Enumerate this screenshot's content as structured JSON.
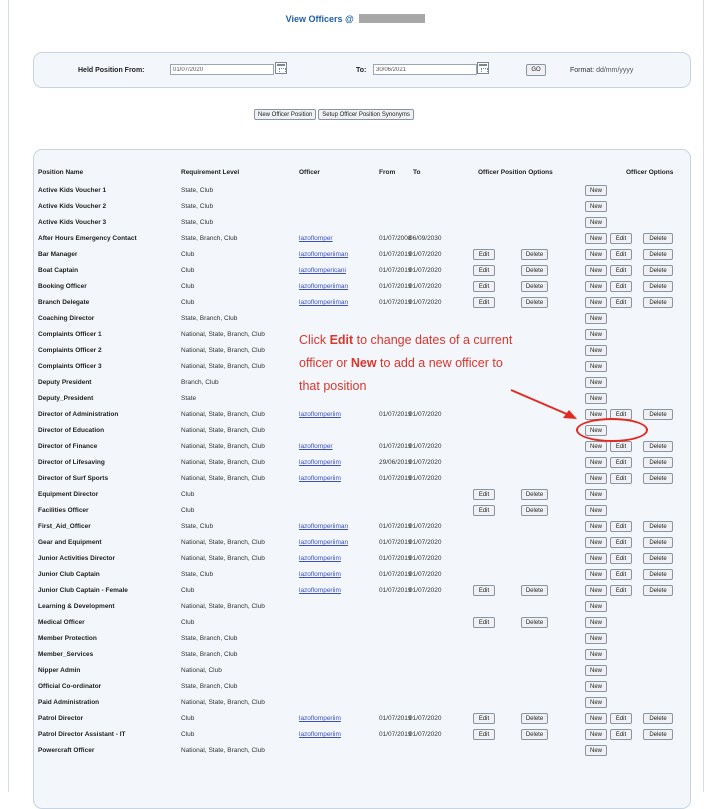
{
  "page": {
    "title": "View Officers @"
  },
  "filter": {
    "held_from_label": "Held Position From:",
    "held_from_value": "01/07/2020",
    "to_label": "To:",
    "to_value": "30/06/2021",
    "go_label": "GO",
    "format_label": "Format:",
    "format_value": "dd/mm/yyyy"
  },
  "actions": {
    "new_officer_position": "New Officer Position",
    "setup_synonyms": "Setup Officer Position Synonyms"
  },
  "table": {
    "headers": {
      "position_name": "Position Name",
      "requirement_level": "Requirement Level",
      "officer": "Officer",
      "from": "From",
      "to": "To",
      "officer_position_options": "Officer Position Options",
      "officer_options": "Officer Options"
    },
    "buttons": {
      "new": "New",
      "edit": "Edit",
      "delete": "Delete"
    },
    "rows": [
      {
        "position": "Active Kids Voucher 1",
        "requirement": "State, Club",
        "officer": "",
        "from": "",
        "to": "",
        "pos_opts": false,
        "new": true,
        "off_opts": false
      },
      {
        "position": "Active Kids Voucher 2",
        "requirement": "State, Club",
        "officer": "",
        "from": "",
        "to": "",
        "pos_opts": false,
        "new": true,
        "off_opts": false
      },
      {
        "position": "Active Kids Voucher 3",
        "requirement": "State, Club",
        "officer": "",
        "from": "",
        "to": "",
        "pos_opts": false,
        "new": true,
        "off_opts": false
      },
      {
        "position": "After Hours Emergency Contact",
        "requirement": "State, Branch, Club",
        "officer": "lazoflomper",
        "from": "01/07/2008",
        "to": "06/09/2030",
        "pos_opts": false,
        "new": true,
        "off_opts": true
      },
      {
        "position": "Bar Manager",
        "requirement": "Club",
        "officer": "lazoflomperiiman",
        "from": "01/07/2019",
        "to": "01/07/2020",
        "pos_opts": true,
        "new": true,
        "off_opts": true
      },
      {
        "position": "Boat Captain",
        "requirement": "Club",
        "officer": "lazoflompericani",
        "from": "01/07/2019",
        "to": "01/07/2020",
        "pos_opts": true,
        "new": true,
        "off_opts": true
      },
      {
        "position": "Booking Officer",
        "requirement": "Club",
        "officer": "lazoflomperiiman",
        "from": "01/07/2019",
        "to": "01/07/2020",
        "pos_opts": true,
        "new": true,
        "off_opts": true
      },
      {
        "position": "Branch Delegate",
        "requirement": "Club",
        "officer": "lazoflomperiiman",
        "from": "01/07/2019",
        "to": "01/07/2020",
        "pos_opts": true,
        "new": true,
        "off_opts": true
      },
      {
        "position": "Coaching Director",
        "requirement": "State, Branch, Club",
        "officer": "",
        "from": "",
        "to": "",
        "pos_opts": false,
        "new": true,
        "off_opts": false
      },
      {
        "position": "Complaints Officer 1",
        "requirement": "National, State, Branch, Club",
        "officer": "",
        "from": "",
        "to": "",
        "pos_opts": false,
        "new": true,
        "off_opts": false
      },
      {
        "position": "Complaints Officer 2",
        "requirement": "National, State, Branch, Club",
        "officer": "",
        "from": "",
        "to": "",
        "pos_opts": false,
        "new": true,
        "off_opts": false
      },
      {
        "position": "Complaints Officer 3",
        "requirement": "National, State, Branch, Club",
        "officer": "",
        "from": "",
        "to": "",
        "pos_opts": false,
        "new": true,
        "off_opts": false
      },
      {
        "position": "Deputy President",
        "requirement": "Branch, Club",
        "officer": "",
        "from": "",
        "to": "",
        "pos_opts": false,
        "new": true,
        "off_opts": false
      },
      {
        "position": "Deputy_President",
        "requirement": "State",
        "officer": "",
        "from": "",
        "to": "",
        "pos_opts": false,
        "new": true,
        "off_opts": false
      },
      {
        "position": "Director of Administration",
        "requirement": "National, State, Branch, Club",
        "officer": "lazoflomperiim",
        "from": "01/07/2019",
        "to": "01/07/2020",
        "pos_opts": false,
        "new": true,
        "off_opts": true
      },
      {
        "position": "Director of Education",
        "requirement": "National, State, Branch, Club",
        "officer": "",
        "from": "",
        "to": "",
        "pos_opts": false,
        "new": true,
        "off_opts": false
      },
      {
        "position": "Director of Finance",
        "requirement": "National, State, Branch, Club",
        "officer": "lazoflomper",
        "from": "01/07/2019",
        "to": "01/07/2020",
        "pos_opts": false,
        "new": true,
        "off_opts": true
      },
      {
        "position": "Director of Lifesaving",
        "requirement": "National, State, Branch, Club",
        "officer": "lazoflomperiim",
        "from": "29/06/2019",
        "to": "01/07/2020",
        "pos_opts": false,
        "new": true,
        "off_opts": true
      },
      {
        "position": "Director of Surf Sports",
        "requirement": "National, State, Branch, Club",
        "officer": "lazoflomperiim",
        "from": "01/07/2019",
        "to": "01/07/2020",
        "pos_opts": false,
        "new": true,
        "off_opts": true
      },
      {
        "position": "Equipment Director",
        "requirement": "Club",
        "officer": "",
        "from": "",
        "to": "",
        "pos_opts": true,
        "new": true,
        "off_opts": false
      },
      {
        "position": "Facilities Officer",
        "requirement": "Club",
        "officer": "",
        "from": "",
        "to": "",
        "pos_opts": true,
        "new": true,
        "off_opts": false
      },
      {
        "position": "First_Aid_Officer",
        "requirement": "State, Club",
        "officer": "lazoflomperiiman",
        "from": "01/07/2019",
        "to": "01/07/2020",
        "pos_opts": false,
        "new": true,
        "off_opts": true
      },
      {
        "position": "Gear and Equipment",
        "requirement": "National, State, Branch, Club",
        "officer": "lazoflomperiiman",
        "from": "01/07/2019",
        "to": "01/07/2020",
        "pos_opts": false,
        "new": true,
        "off_opts": true
      },
      {
        "position": "Junior Activities Director",
        "requirement": "National, State, Branch, Club",
        "officer": "lazoflomperiim",
        "from": "01/07/2019",
        "to": "01/07/2020",
        "pos_opts": false,
        "new": true,
        "off_opts": true
      },
      {
        "position": "Junior Club Captain",
        "requirement": "State, Club",
        "officer": "lazoflomperiim",
        "from": "01/07/2019",
        "to": "01/07/2020",
        "pos_opts": false,
        "new": true,
        "off_opts": true
      },
      {
        "position": "Junior Club Captain - Female",
        "requirement": "Club",
        "officer": "lazoflomperiim",
        "from": "01/07/2019",
        "to": "01/07/2020",
        "pos_opts": true,
        "new": true,
        "off_opts": true
      },
      {
        "position": "Learning & Development",
        "requirement": "National, State, Branch, Club",
        "officer": "",
        "from": "",
        "to": "",
        "pos_opts": false,
        "new": true,
        "off_opts": false
      },
      {
        "position": "Medical Officer",
        "requirement": "Club",
        "officer": "",
        "from": "",
        "to": "",
        "pos_opts": true,
        "new": true,
        "off_opts": false
      },
      {
        "position": "Member Protection",
        "requirement": "State, Branch, Club",
        "officer": "",
        "from": "",
        "to": "",
        "pos_opts": false,
        "new": true,
        "off_opts": false
      },
      {
        "position": "Member_Services",
        "requirement": "State, Branch, Club",
        "officer": "",
        "from": "",
        "to": "",
        "pos_opts": false,
        "new": true,
        "off_opts": false
      },
      {
        "position": "Nipper Admin",
        "requirement": "National, Club",
        "officer": "",
        "from": "",
        "to": "",
        "pos_opts": false,
        "new": true,
        "off_opts": false
      },
      {
        "position": "Official Co-ordinator",
        "requirement": "State, Branch, Club",
        "officer": "",
        "from": "",
        "to": "",
        "pos_opts": false,
        "new": true,
        "off_opts": false
      },
      {
        "position": "Paid Administration",
        "requirement": "National, State, Branch, Club",
        "officer": "",
        "from": "",
        "to": "",
        "pos_opts": false,
        "new": true,
        "off_opts": false
      },
      {
        "position": "Patrol Director",
        "requirement": "Club",
        "officer": "lazoflomperiim",
        "from": "01/07/2019",
        "to": "01/07/2020",
        "pos_opts": true,
        "new": true,
        "off_opts": true
      },
      {
        "position": "Patrol Director Assistant - IT",
        "requirement": "Club",
        "officer": "lazoflomperiim",
        "from": "01/07/2019",
        "to": "01/07/2020",
        "pos_opts": true,
        "new": true,
        "off_opts": true
      },
      {
        "position": "Powercraft Officer",
        "requirement": "National, State, Branch, Club",
        "officer": "",
        "from": "",
        "to": "",
        "pos_opts": false,
        "new": true,
        "off_opts": false
      }
    ]
  },
  "annotation": {
    "line1_a": "Click ",
    "line1_b": "Edit",
    "line1_c": " to change dates of a current",
    "line2_a": "officer or ",
    "line2_b": "New",
    "line2_c": " to add a new officer to",
    "line3": "that position",
    "color": "#d9362e"
  },
  "colors": {
    "panel_bg": "#f3f6fa",
    "title": "#1f5fa8",
    "link": "#3a4fc2",
    "highlight": "#e22a22"
  }
}
